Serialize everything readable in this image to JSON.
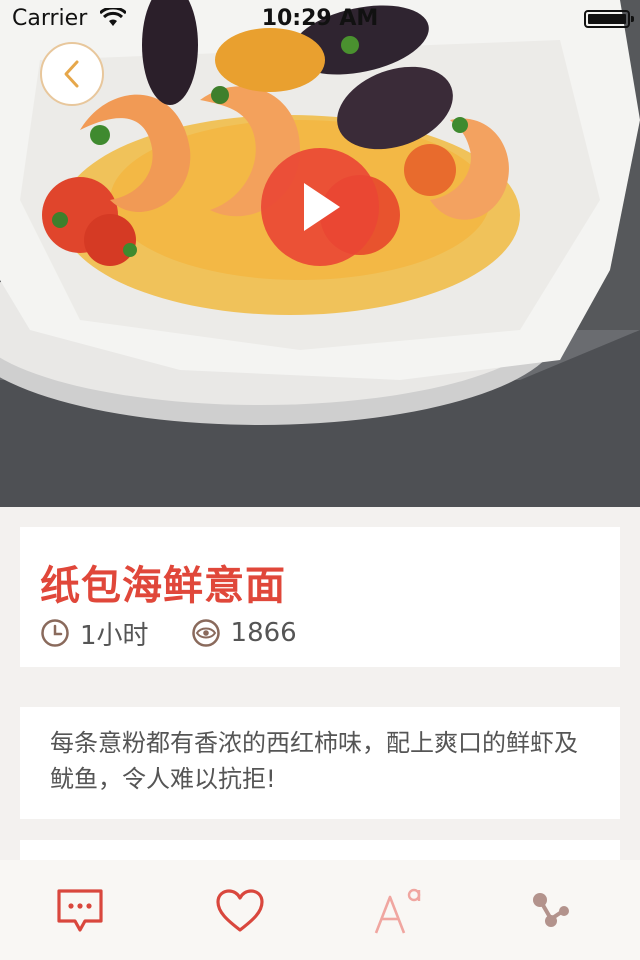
{
  "status_bar": {
    "carrier": "Carrier",
    "time": "10:29 AM"
  },
  "recipe": {
    "title": "纸包海鲜意面",
    "duration": "1小时",
    "views": "1866",
    "description": "每条意粉都有香浓的西红柿味，配上爽口的鲜虾及鱿鱼，令人难以抗拒!"
  },
  "toolbar": {
    "items": [
      {
        "icon": "comment-icon"
      },
      {
        "icon": "heart-icon"
      },
      {
        "icon": "font-size-icon"
      },
      {
        "icon": "share-icon"
      }
    ]
  },
  "colors": {
    "accent": "#e0473a",
    "back_button_border": "#e8c79c",
    "back_chevron": "#e6a74a",
    "play_button": "#ea4634",
    "toolbar_icon_active": "#d9473d",
    "toolbar_icon_light": "#f0a6a0",
    "toolbar_icon_share": "#b3938c"
  }
}
